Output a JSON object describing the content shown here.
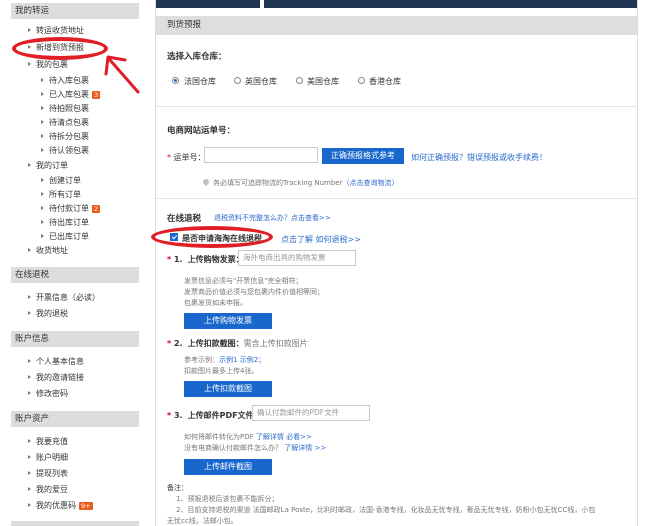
{
  "sidebar": {
    "section1": {
      "title": "我的转运",
      "items": [
        {
          "label": "转运收货地址"
        },
        {
          "label": "新增到货预报"
        },
        {
          "label": "我的包裹"
        },
        {
          "label": "待入库包裹"
        },
        {
          "label": "已入库包裹",
          "badge": "3"
        },
        {
          "label": "待拍照包裹"
        },
        {
          "label": "待清点包裹"
        },
        {
          "label": "待拆分包裹"
        },
        {
          "label": "待认领包裹"
        },
        {
          "label": "我的订单"
        },
        {
          "label": "创建订单"
        },
        {
          "label": "所有订单"
        },
        {
          "label": "待付款订单",
          "badge": "2"
        },
        {
          "label": "待出库订单"
        },
        {
          "label": "已出库订单"
        },
        {
          "label": "收货地址"
        }
      ]
    },
    "section2": {
      "title": "在线退税",
      "items": [
        {
          "label": "开票信息（必读）"
        },
        {
          "label": "我的退税"
        }
      ]
    },
    "section3": {
      "title": "账户信息",
      "items": [
        {
          "label": "个人基本信息"
        },
        {
          "label": "我的邀请链接"
        },
        {
          "label": "修改密码"
        }
      ]
    },
    "section4": {
      "title": "账户资产",
      "items": [
        {
          "label": "我要充值"
        },
        {
          "label": "账户明细"
        },
        {
          "label": "提现列表"
        },
        {
          "label": "我的爱豆"
        },
        {
          "label": "我的优惠码",
          "badge": "9+"
        }
      ]
    }
  },
  "panel": {
    "title": "到货预报",
    "warehouse": {
      "label": "选择入库仓库：",
      "options": [
        "法国仓库",
        "英国仓库",
        "美国仓库",
        "香港仓库"
      ],
      "selected": "法国仓库"
    },
    "tracking": {
      "section_title": "电商网站运单号：",
      "field_label": "运单号：",
      "input_value": "",
      "format_button": "正确预报格式参考",
      "help_link": "如何正确预报？错误预报或收手续费！",
      "hint": "务必填写可追踪物流的Tracking Number",
      "hint_link": "（点击查询物流）"
    },
    "refund": {
      "title": "在线退税",
      "incomplete_link": "退税资料不完整怎么办？点击查看>>",
      "checkbox_label": "是否申请海淘在线退税",
      "checkbox_checked": true,
      "how_link": "点击了解 如何退税>>",
      "step1": {
        "num": "1.",
        "label": "上传购物发票：",
        "placeholder": "海外电商出具的购物发票",
        "notes": [
          "发票信息必须与\"开票信息\"完全相符；",
          "发票商品价值必须与您包裹内件价值相等同；",
          "包裹发货如未申报。"
        ],
        "button": "上传购物发票"
      },
      "step2": {
        "num": "2.",
        "label": "上传扣款截图：",
        "hint": "需含上传扣款图片",
        "example_label": "参考示例：",
        "example1": "示例1",
        "example2": "示例2；",
        "limit": "扣款图片最多上传4张。",
        "button": "上传扣款截图"
      },
      "step3": {
        "num": "3.",
        "label": "上传邮件PDF文件：",
        "placeholder": "确认付款邮件的PDF文件",
        "q1": "如何将邮件转化为PDF",
        "q1_link": "了解详情 必看>>",
        "q2": "没有电商确认付款邮件怎么办？",
        "q2_link": "了解详情 >>",
        "button": "上传邮件截图"
      }
    },
    "notes": {
      "title": "备注：",
      "lines": [
        "1、预报退税后该包裹不能拆分；",
        "2、目前支持退税的渠道 法国邮政La Poste，比利时邮政，法国-香港专线，化妆品无忧专线，奢品无忧专线，奶粉小包无忧CC线，小包",
        "无忧cc线，法邮小包。"
      ]
    }
  },
  "colors": {
    "accent": "#1967cd",
    "badge": "#e85d1e",
    "annotation": "#e11e25",
    "header_bg": "#dedede",
    "topbar": "#1f3551"
  }
}
